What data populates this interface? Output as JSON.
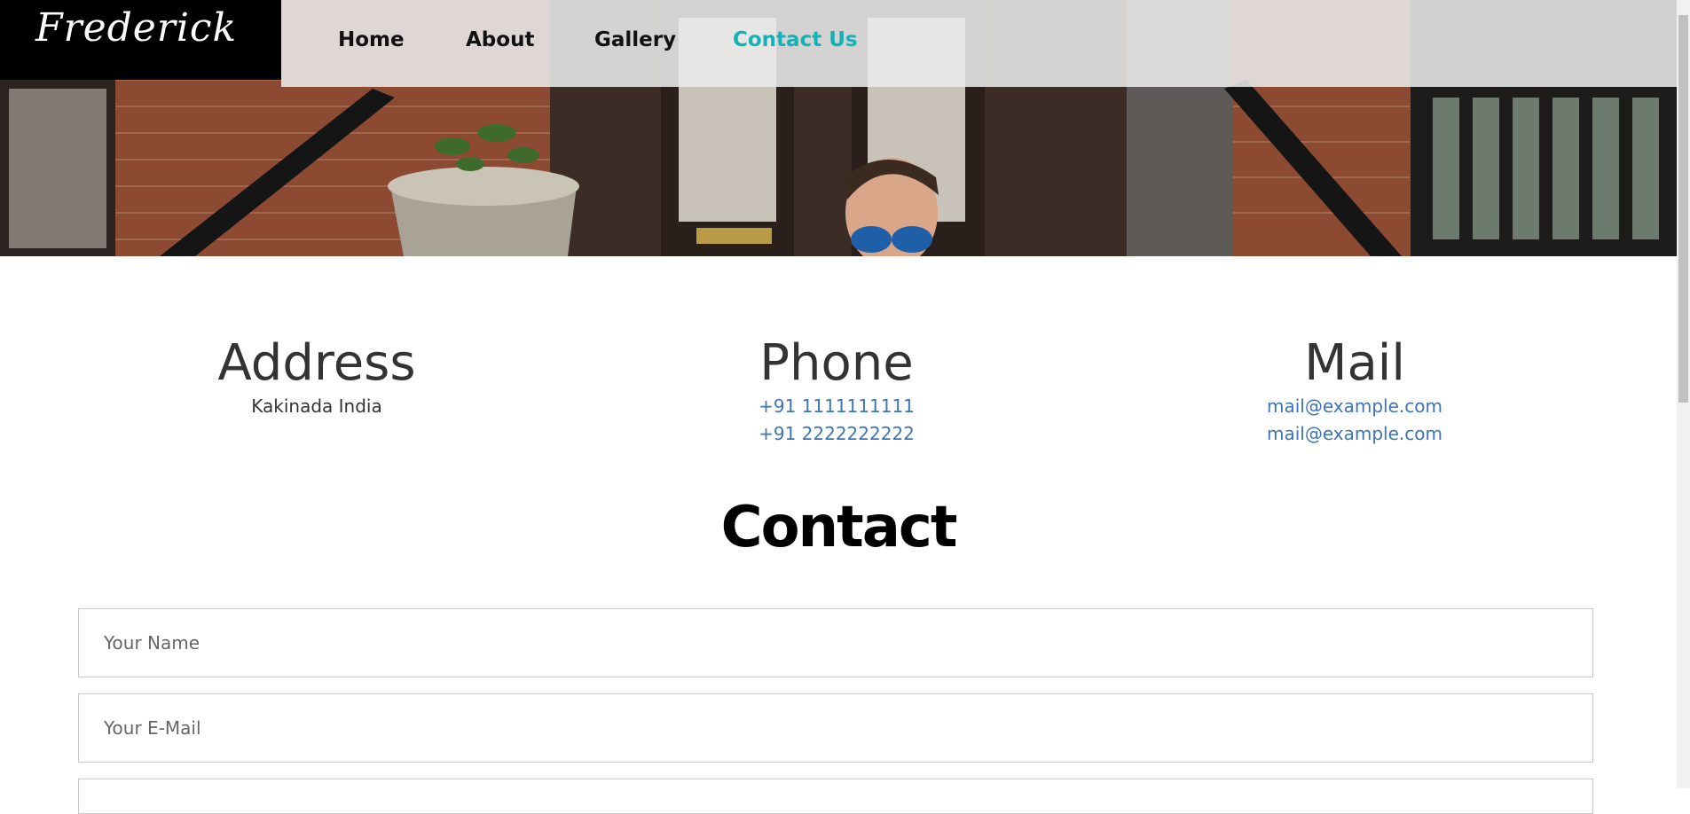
{
  "brand": {
    "logo_text": "Frederick"
  },
  "nav": {
    "items": [
      {
        "label": "Home"
      },
      {
        "label": "About"
      },
      {
        "label": "Gallery"
      },
      {
        "label": "Contact Us"
      }
    ],
    "active_color": "#13b1b8"
  },
  "info": {
    "address": {
      "title": "Address",
      "lines": [
        "Kakinada India"
      ]
    },
    "phone": {
      "title": "Phone",
      "lines": [
        "+91 1111111111",
        "+91 2222222222"
      ]
    },
    "mail": {
      "title": "Mail",
      "lines": [
        "mail@example.com",
        "mail@example.com"
      ]
    }
  },
  "contact": {
    "heading": "Contact",
    "name_placeholder": "Your Name",
    "email_placeholder": "Your E-Mail"
  },
  "colors": {
    "link": "#3c74b6",
    "accent": "#13b1b8"
  }
}
